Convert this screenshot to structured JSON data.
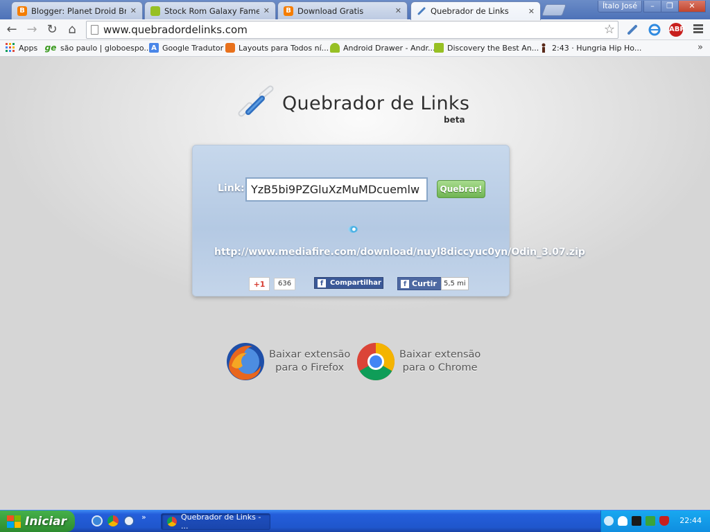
{
  "window": {
    "user_name": "Ítalo José",
    "minimize": "–",
    "maximize": "❐",
    "close": "✕"
  },
  "tabs": [
    {
      "label": "Blogger: Planet Droid Brasil -",
      "icon": "blogger-icon",
      "active": false
    },
    {
      "label": "Stock Rom Galaxy Fame (GT",
      "icon": "android-icon",
      "active": false
    },
    {
      "label": "Download Gratis",
      "icon": "blogger-icon",
      "active": false
    },
    {
      "label": "Quebrador de Links",
      "icon": "link-icon",
      "active": true
    }
  ],
  "tab_close": "✕",
  "toolbar": {
    "back": "←",
    "forward": "→",
    "reload": "↻",
    "home": "⌂",
    "url": "www.quebradordelinks.com",
    "star": "☆",
    "abp": "ABP"
  },
  "bookmarks": [
    {
      "label": "Apps",
      "icon": "apps-grid-icon"
    },
    {
      "label": "são paulo | globoespo...",
      "icon": "ge-icon",
      "icon_text": "ge"
    },
    {
      "label": "Google Tradutor",
      "icon": "translate-icon"
    },
    {
      "label": "Layouts para Todos ní...",
      "icon": "layouts-icon"
    },
    {
      "label": "Android Drawer - Andr...",
      "icon": "android-icon"
    },
    {
      "label": "Discovery the Best An...",
      "icon": "android-icon"
    },
    {
      "label": "2:43 · Hungria Hip Ho...",
      "icon": "person-icon"
    }
  ],
  "bookmarks_more": "»",
  "page": {
    "logo_name": "Quebrador de Links",
    "logo_beta": "beta",
    "link_label": "Link:",
    "link_value": "YzB5bi9PZGluXzMuMDcuemlw",
    "break_button": "Quebrar!",
    "result_url": "http://www.mediafire.com/download/nuyl8diccyuc0yn/Odin_3.07.zip",
    "gplus_label": "+1",
    "gplus_count": "636",
    "share_label": "Compartilhar",
    "like_label": "Curtir",
    "like_count": "5,5 mi",
    "fb_letter": "f",
    "firefox_line1": "Baixar extensão",
    "firefox_line2": "para o Firefox",
    "chrome_line1": "Baixar extensão",
    "chrome_line2": "para o Chrome"
  },
  "taskbar": {
    "start_label": "Iniciar",
    "quicklaunch_more": "»",
    "task_label": "Quebrador de Links - ...",
    "clock": "22:44"
  },
  "colors": {
    "accent_green": "#6fb452",
    "facebook_blue": "#3b5998",
    "xp_blue": "#245edb"
  }
}
